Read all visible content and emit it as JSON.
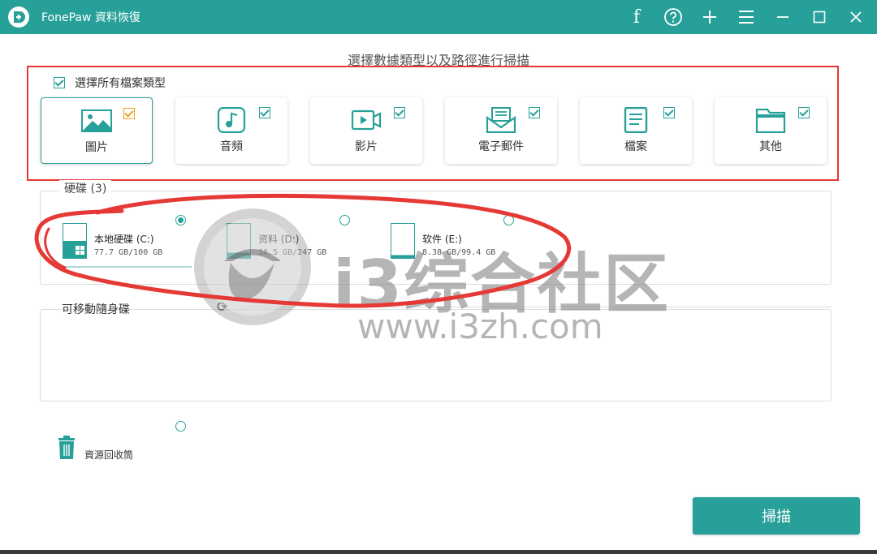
{
  "app": {
    "title": "FonePaw 資料恢復"
  },
  "titlebar_icons": [
    "facebook-icon",
    "help-icon",
    "plus-icon",
    "menu-icon",
    "minimize-icon",
    "maximize-icon",
    "close-icon"
  ],
  "heading": "選擇數據類型以及路徑進行掃描",
  "file_types": {
    "select_all_label": "選擇所有檔案類型",
    "select_all_checked": true,
    "items": [
      {
        "label": "圖片",
        "icon": "image-icon",
        "checked": true,
        "selected": true
      },
      {
        "label": "音頻",
        "icon": "music-icon",
        "checked": true,
        "selected": false
      },
      {
        "label": "影片",
        "icon": "video-icon",
        "checked": true,
        "selected": false
      },
      {
        "label": "電子郵件",
        "icon": "email-icon",
        "checked": true,
        "selected": false
      },
      {
        "label": "檔案",
        "icon": "document-icon",
        "checked": true,
        "selected": false
      },
      {
        "label": "其他",
        "icon": "folder-icon",
        "checked": true,
        "selected": false
      }
    ]
  },
  "hard_drives": {
    "label": "硬碟 (3)",
    "drives": [
      {
        "name": "本地硬碟 (C:)",
        "size": "77.7 GB/100 GB",
        "selected": true
      },
      {
        "name": "资料 (D:)",
        "size": "38.5 GB/247 GB",
        "selected": false
      },
      {
        "name": "软件 (E:)",
        "size": "8.38 GB/99.4 GB",
        "selected": false
      }
    ]
  },
  "removable": {
    "label": "可移動隨身碟"
  },
  "recycle_bin": {
    "label": "資源回收筒",
    "selected": false
  },
  "scan_button": "掃描",
  "watermark": {
    "text": "i3综合社区",
    "url": "www.i3zh.com"
  },
  "colors": {
    "accent": "#26a098",
    "annotation": "#e53935",
    "checkbox_selected": "#f0a020"
  }
}
